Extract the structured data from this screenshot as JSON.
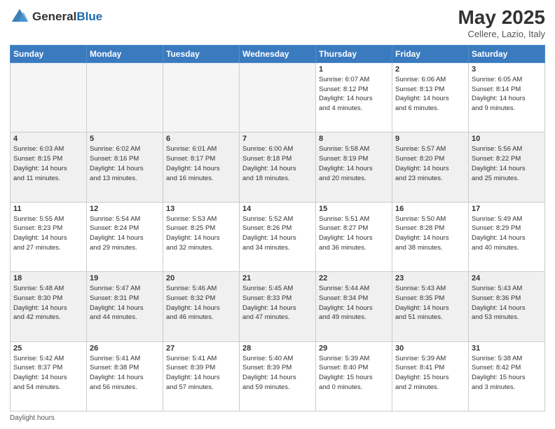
{
  "header": {
    "logo_general": "General",
    "logo_blue": "Blue",
    "month_title": "May 2025",
    "location": "Cellere, Lazio, Italy"
  },
  "days_of_week": [
    "Sunday",
    "Monday",
    "Tuesday",
    "Wednesday",
    "Thursday",
    "Friday",
    "Saturday"
  ],
  "footer_text": "Daylight hours",
  "weeks": [
    [
      {
        "day": "",
        "info": ""
      },
      {
        "day": "",
        "info": ""
      },
      {
        "day": "",
        "info": ""
      },
      {
        "day": "",
        "info": ""
      },
      {
        "day": "1",
        "info": "Sunrise: 6:07 AM\nSunset: 8:12 PM\nDaylight: 14 hours\nand 4 minutes."
      },
      {
        "day": "2",
        "info": "Sunrise: 6:06 AM\nSunset: 8:13 PM\nDaylight: 14 hours\nand 6 minutes."
      },
      {
        "day": "3",
        "info": "Sunrise: 6:05 AM\nSunset: 8:14 PM\nDaylight: 14 hours\nand 9 minutes."
      }
    ],
    [
      {
        "day": "4",
        "info": "Sunrise: 6:03 AM\nSunset: 8:15 PM\nDaylight: 14 hours\nand 11 minutes."
      },
      {
        "day": "5",
        "info": "Sunrise: 6:02 AM\nSunset: 8:16 PM\nDaylight: 14 hours\nand 13 minutes."
      },
      {
        "day": "6",
        "info": "Sunrise: 6:01 AM\nSunset: 8:17 PM\nDaylight: 14 hours\nand 16 minutes."
      },
      {
        "day": "7",
        "info": "Sunrise: 6:00 AM\nSunset: 8:18 PM\nDaylight: 14 hours\nand 18 minutes."
      },
      {
        "day": "8",
        "info": "Sunrise: 5:58 AM\nSunset: 8:19 PM\nDaylight: 14 hours\nand 20 minutes."
      },
      {
        "day": "9",
        "info": "Sunrise: 5:57 AM\nSunset: 8:20 PM\nDaylight: 14 hours\nand 23 minutes."
      },
      {
        "day": "10",
        "info": "Sunrise: 5:56 AM\nSunset: 8:22 PM\nDaylight: 14 hours\nand 25 minutes."
      }
    ],
    [
      {
        "day": "11",
        "info": "Sunrise: 5:55 AM\nSunset: 8:23 PM\nDaylight: 14 hours\nand 27 minutes."
      },
      {
        "day": "12",
        "info": "Sunrise: 5:54 AM\nSunset: 8:24 PM\nDaylight: 14 hours\nand 29 minutes."
      },
      {
        "day": "13",
        "info": "Sunrise: 5:53 AM\nSunset: 8:25 PM\nDaylight: 14 hours\nand 32 minutes."
      },
      {
        "day": "14",
        "info": "Sunrise: 5:52 AM\nSunset: 8:26 PM\nDaylight: 14 hours\nand 34 minutes."
      },
      {
        "day": "15",
        "info": "Sunrise: 5:51 AM\nSunset: 8:27 PM\nDaylight: 14 hours\nand 36 minutes."
      },
      {
        "day": "16",
        "info": "Sunrise: 5:50 AM\nSunset: 8:28 PM\nDaylight: 14 hours\nand 38 minutes."
      },
      {
        "day": "17",
        "info": "Sunrise: 5:49 AM\nSunset: 8:29 PM\nDaylight: 14 hours\nand 40 minutes."
      }
    ],
    [
      {
        "day": "18",
        "info": "Sunrise: 5:48 AM\nSunset: 8:30 PM\nDaylight: 14 hours\nand 42 minutes."
      },
      {
        "day": "19",
        "info": "Sunrise: 5:47 AM\nSunset: 8:31 PM\nDaylight: 14 hours\nand 44 minutes."
      },
      {
        "day": "20",
        "info": "Sunrise: 5:46 AM\nSunset: 8:32 PM\nDaylight: 14 hours\nand 46 minutes."
      },
      {
        "day": "21",
        "info": "Sunrise: 5:45 AM\nSunset: 8:33 PM\nDaylight: 14 hours\nand 47 minutes."
      },
      {
        "day": "22",
        "info": "Sunrise: 5:44 AM\nSunset: 8:34 PM\nDaylight: 14 hours\nand 49 minutes."
      },
      {
        "day": "23",
        "info": "Sunrise: 5:43 AM\nSunset: 8:35 PM\nDaylight: 14 hours\nand 51 minutes."
      },
      {
        "day": "24",
        "info": "Sunrise: 5:43 AM\nSunset: 8:36 PM\nDaylight: 14 hours\nand 53 minutes."
      }
    ],
    [
      {
        "day": "25",
        "info": "Sunrise: 5:42 AM\nSunset: 8:37 PM\nDaylight: 14 hours\nand 54 minutes."
      },
      {
        "day": "26",
        "info": "Sunrise: 5:41 AM\nSunset: 8:38 PM\nDaylight: 14 hours\nand 56 minutes."
      },
      {
        "day": "27",
        "info": "Sunrise: 5:41 AM\nSunset: 8:39 PM\nDaylight: 14 hours\nand 57 minutes."
      },
      {
        "day": "28",
        "info": "Sunrise: 5:40 AM\nSunset: 8:39 PM\nDaylight: 14 hours\nand 59 minutes."
      },
      {
        "day": "29",
        "info": "Sunrise: 5:39 AM\nSunset: 8:40 PM\nDaylight: 15 hours\nand 0 minutes."
      },
      {
        "day": "30",
        "info": "Sunrise: 5:39 AM\nSunset: 8:41 PM\nDaylight: 15 hours\nand 2 minutes."
      },
      {
        "day": "31",
        "info": "Sunrise: 5:38 AM\nSunset: 8:42 PM\nDaylight: 15 hours\nand 3 minutes."
      }
    ]
  ]
}
